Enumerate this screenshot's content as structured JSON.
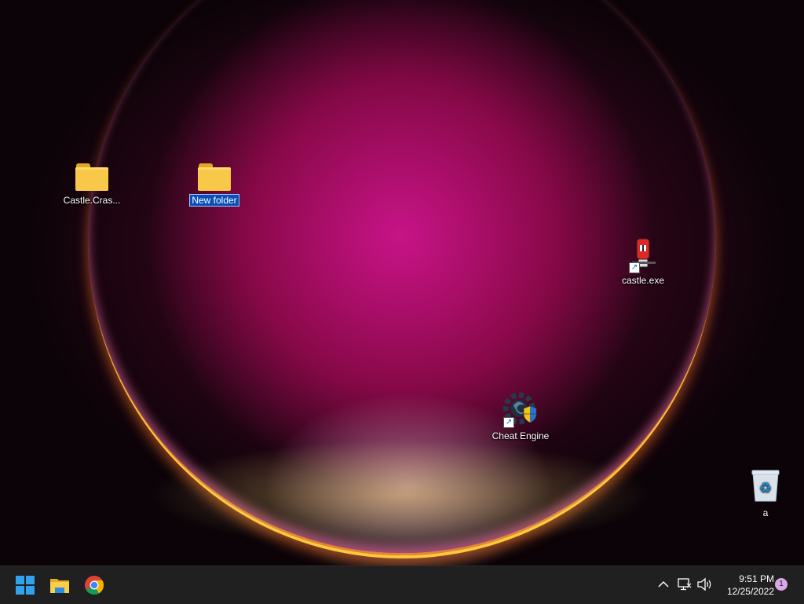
{
  "desktop": {
    "icons": [
      {
        "label": "Castle.Cras...",
        "type": "folder"
      },
      {
        "label": "New folder",
        "type": "folder",
        "selected": true
      },
      {
        "label": "castle.exe",
        "type": "shortcut"
      },
      {
        "label": "Cheat Engine",
        "type": "shortcut"
      },
      {
        "label": "a",
        "type": "recycle-bin"
      }
    ]
  },
  "taskbar": {
    "pinned": [
      {
        "name": "Start",
        "icon": "windows-start-icon"
      },
      {
        "name": "File Explorer",
        "icon": "file-explorer-icon"
      },
      {
        "name": "Google Chrome",
        "icon": "chrome-icon"
      }
    ],
    "tray": {
      "time": "9:51 PM",
      "date": "12/25/2022",
      "notification_count": "1"
    }
  },
  "colors": {
    "selection": "#0a4fb8",
    "taskbar": "#202020",
    "notification_badge": "#d9a7e6"
  }
}
